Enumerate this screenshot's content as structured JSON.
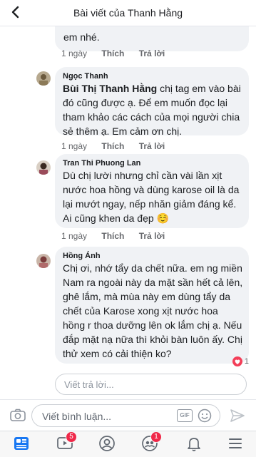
{
  "header": {
    "title": "Bài viết của Thanh Hằng"
  },
  "top_comment": {
    "cut_text": "em nhé.",
    "meta": {
      "time": "1 ngày",
      "like": "Thích",
      "reply": "Trả lời"
    }
  },
  "comments": [
    {
      "name": "Ngọc Thanh",
      "mention": "Bùi Thị Thanh Hằng",
      "line1_rest": " chị tag em vào bài",
      "lines": [
        "đó cũng được ạ. Để em muốn đọc lại",
        "tham khảo các cách của mọi người chia",
        "sẻ thêm ạ. Em cảm ơn chị."
      ],
      "meta": {
        "time": "1 ngày",
        "like": "Thích",
        "reply": "Trả lời"
      }
    },
    {
      "name": "Tran Thi Phuong Lan",
      "lines": [
        "Dù chị lười nhưng chỉ cần vài lần xịt",
        "nước hoa hồng và dùng karose oil là da",
        "lại mướt ngay, nếp nhăn giảm đáng kể.",
        "Ai cũng khen da đẹp ☺️"
      ],
      "meta": {
        "time": "1 ngày",
        "like": "Thích",
        "reply": "Trả lời"
      }
    },
    {
      "name": "Hồng Ánh",
      "lines": [
        "Chị ơi, nhớ tẩy da chết nữa. em ng miền",
        "Nam ra ngoài này da mặt sần hết cả lên,",
        "ghê lắm, mà mùa này em dùng tẩy da",
        "chết của Karose xong xịt nước hoa",
        "hồng r thoa dưỡng lên ok lắm chị ạ. Nếu",
        "đắp mặt nạ nữa thì khỏi bàn luôn ấy. Chị",
        "thử xem có cải thiện ko?"
      ],
      "reaction_count": "1"
    }
  ],
  "reply_input": {
    "placeholder": "Viết trả lời..."
  },
  "composer": {
    "placeholder": "Viết bình luận...",
    "gif": "GIF"
  },
  "tabbar": {
    "video_badge": "5",
    "groups_badge": "1"
  },
  "colors": {
    "accent": "#1877f2",
    "badge": "#f02849",
    "bubble": "#f0f2f5"
  }
}
